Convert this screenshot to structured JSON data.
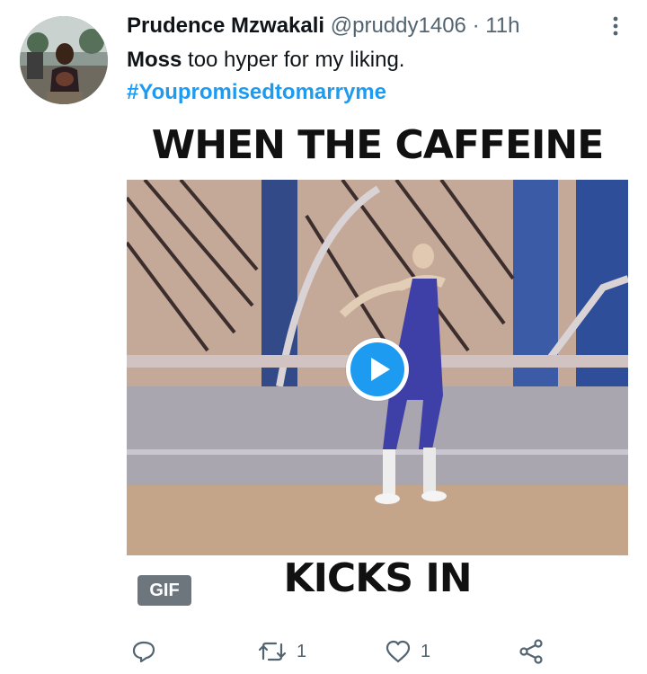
{
  "tweet": {
    "display_name": "Prudence Mzwakali",
    "handle": "@pruddy1406",
    "separator": "·",
    "time": "11h",
    "text_bold": "Moss",
    "text_rest": " too hyper for my liking.",
    "hashtag": "#Youpromisedtomarryme"
  },
  "media": {
    "caption_top": "WHEN THE CAFFEINE",
    "caption_bottom": "KICKS IN",
    "badge": "GIF"
  },
  "actions": {
    "replies": "",
    "retweets": "1",
    "likes": "1"
  },
  "icons": [
    "more-icon",
    "play-icon",
    "reply-icon",
    "retweet-icon",
    "like-icon",
    "share-icon"
  ],
  "colors": {
    "accent": "#1d9bf0",
    "muted": "#536471",
    "text": "#0f1419"
  }
}
